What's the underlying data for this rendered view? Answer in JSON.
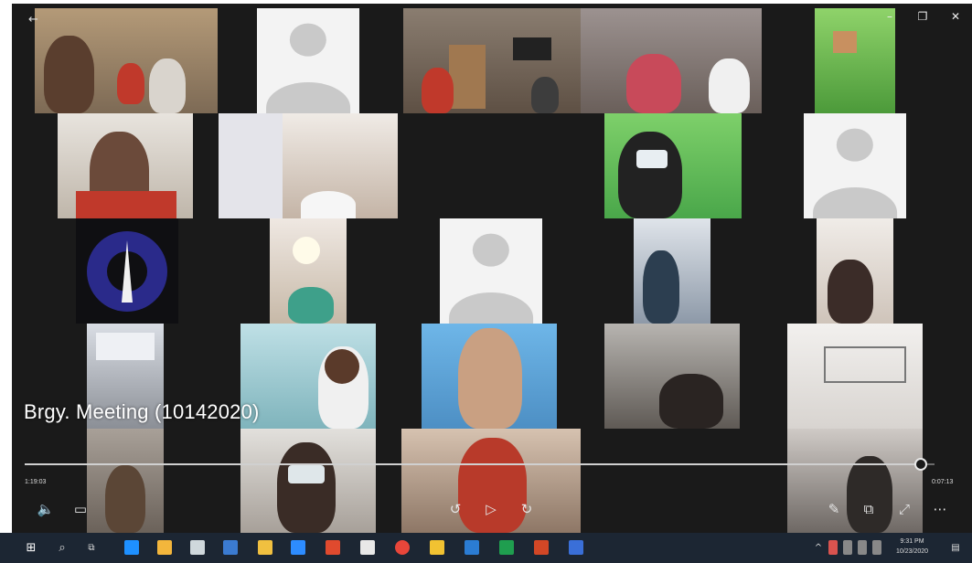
{
  "window": {
    "back_glyph": "←",
    "minimize_glyph": "–",
    "maximize_glyph": "❐",
    "close_glyph": "✕"
  },
  "video": {
    "title": "Brgy. Meeting (10142020)",
    "time_elapsed": "1:19:03",
    "time_remaining": "0:07:13",
    "progress_fraction": 0.985
  },
  "controls": {
    "volume_icon": "volume-icon",
    "volume_glyph": "🔈",
    "captions_icon": "captions-icon",
    "captions_glyph": "▭",
    "rewind_icon": "skip-back-icon",
    "rewind_glyph": "↺",
    "play_icon": "play-icon",
    "play_glyph": "▷",
    "forward_icon": "skip-forward-icon",
    "forward_glyph": "↻",
    "edit_icon": "edit-pen-icon",
    "edit_glyph": "✎",
    "cast_icon": "cast-icon",
    "cast_glyph": "⧉",
    "fullscreen_icon": "fullscreen-icon",
    "fullscreen_glyph": "⤢",
    "more_icon": "more-icon",
    "more_glyph": "⋯"
  },
  "taskbar": {
    "start_glyph": "⊞",
    "search_glyph": "⌕",
    "taskview_glyph": "⧉",
    "clock_time": "9:31 PM",
    "clock_date": "10/23/2020",
    "notification_glyph": "▤",
    "tray_chevron_glyph": "^"
  },
  "colors": {
    "player_bg": "#1a1a1a",
    "taskbar_bg": "#1c2633",
    "avatar_bg": "#f3f3f3",
    "avatar_fg": "#c9c9c9",
    "accent": "#0078d7"
  }
}
